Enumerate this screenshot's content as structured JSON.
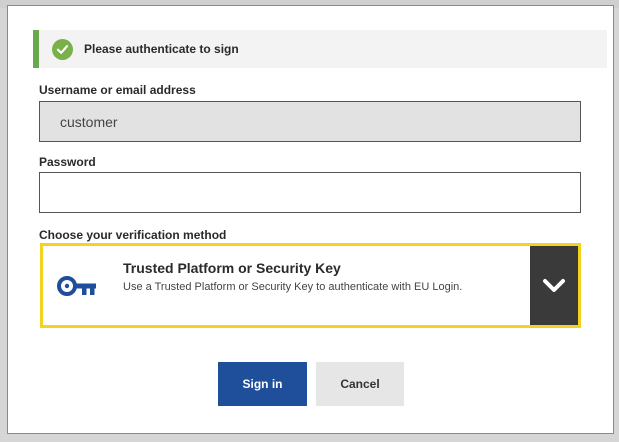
{
  "banner": {
    "message": "Please authenticate to sign",
    "status_color": "#79b04a"
  },
  "username": {
    "label": "Username or email address",
    "value": "customer"
  },
  "password": {
    "label": "Password",
    "value": ""
  },
  "verification": {
    "label": "Choose your verification method",
    "method_title": "Trusted Platform or Security Key",
    "method_description": "Use a Trusted Platform or Security Key to authenticate with EU Login.",
    "icon": "key-icon",
    "toggle_icon": "chevron-down-icon",
    "highlight_color": "#f4d320"
  },
  "actions": {
    "signin_label": "Sign in",
    "cancel_label": "Cancel",
    "primary_color": "#1f4e9b"
  }
}
